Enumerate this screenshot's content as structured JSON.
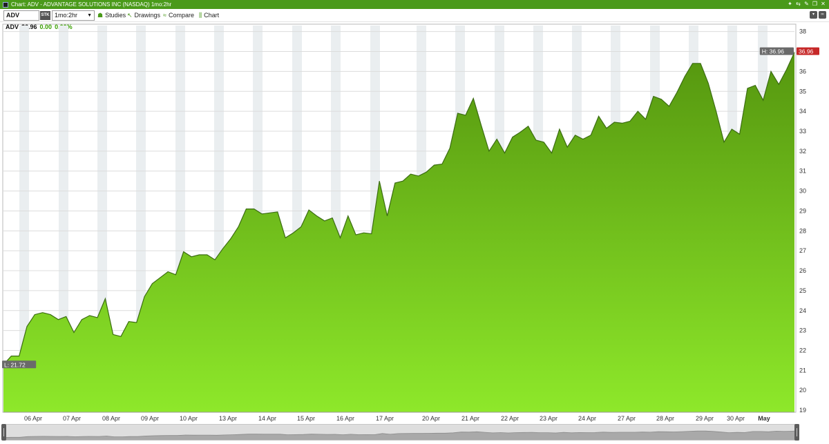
{
  "window": {
    "title": "Chart: ADV - ADVANTAGE SOLUTIONS INC (NASDAQ) 1mo:2hr"
  },
  "toolbar": {
    "symbol": "ADV",
    "type_badge": "STK",
    "period": "1mo:2hr",
    "studies_label": "Studies",
    "drawings_label": "Drawings",
    "compare_label": "Compare",
    "chart_label": "Chart"
  },
  "quote": {
    "symbol": "ADV",
    "last": "36.96",
    "change": "0.00",
    "change_pct": "0.00%"
  },
  "colors": {
    "titlebar": "#4a9a1a",
    "area_top": "#55960f",
    "area_bottom": "#8ee82a",
    "line": "#3b6c12",
    "current_price_badge": "#c62828",
    "high_low_badge": "#6a6a6a"
  },
  "chart_data": {
    "type": "area",
    "ylim": [
      18.9,
      38.3
    ],
    "y_ticks": [
      19,
      20,
      21,
      22,
      23,
      24,
      25,
      26,
      27,
      28,
      29,
      30,
      31,
      32,
      33,
      34,
      35,
      36,
      37,
      38
    ],
    "x_labels": [
      "06 Apr",
      "07 Apr",
      "08 Apr",
      "09 Apr",
      "10 Apr",
      "13 Apr",
      "14 Apr",
      "15 Apr",
      "16 Apr",
      "17 Apr",
      "20 Apr",
      "21 Apr",
      "22 Apr",
      "23 Apr",
      "24 Apr",
      "27 Apr",
      "28 Apr",
      "29 Apr",
      "30 Apr",
      "May"
    ],
    "high_label": "H: 36.96",
    "low_label": "L: 21.72",
    "last_price_label": "36.96",
    "series": [
      {
        "values": [
          21.28,
          21.72,
          21.72,
          23.2,
          23.8,
          23.9,
          23.8,
          23.55,
          23.7,
          22.9,
          23.55,
          23.75,
          23.65,
          24.6,
          22.8,
          22.7,
          23.45,
          23.4,
          24.7,
          25.35,
          25.65,
          25.95,
          25.8,
          26.95,
          26.7,
          26.8,
          26.8,
          26.55,
          27.1,
          27.6,
          28.2,
          29.1,
          29.1,
          28.85,
          28.9,
          28.95,
          27.65,
          27.9,
          28.2,
          29.05,
          28.75,
          28.5,
          28.65,
          27.65,
          28.75,
          27.8,
          27.9,
          27.85,
          30.5,
          28.75,
          30.4,
          30.5,
          30.85,
          30.75,
          30.95,
          31.3,
          31.35,
          32.15,
          33.9,
          33.8,
          34.65,
          33.3,
          32.0,
          32.6,
          31.9,
          32.7,
          32.95,
          33.25,
          32.55,
          32.45,
          31.9,
          33.1,
          32.2,
          32.8,
          32.6,
          32.8,
          33.75,
          33.15,
          33.45,
          33.4,
          33.5,
          34.0,
          33.6,
          34.75,
          34.6,
          34.25,
          34.95,
          35.75,
          36.4,
          36.4,
          35.4,
          34.0,
          32.45,
          33.1,
          32.85,
          35.15,
          35.3,
          34.55,
          36.0,
          35.35,
          36.1,
          36.96
        ]
      }
    ]
  }
}
